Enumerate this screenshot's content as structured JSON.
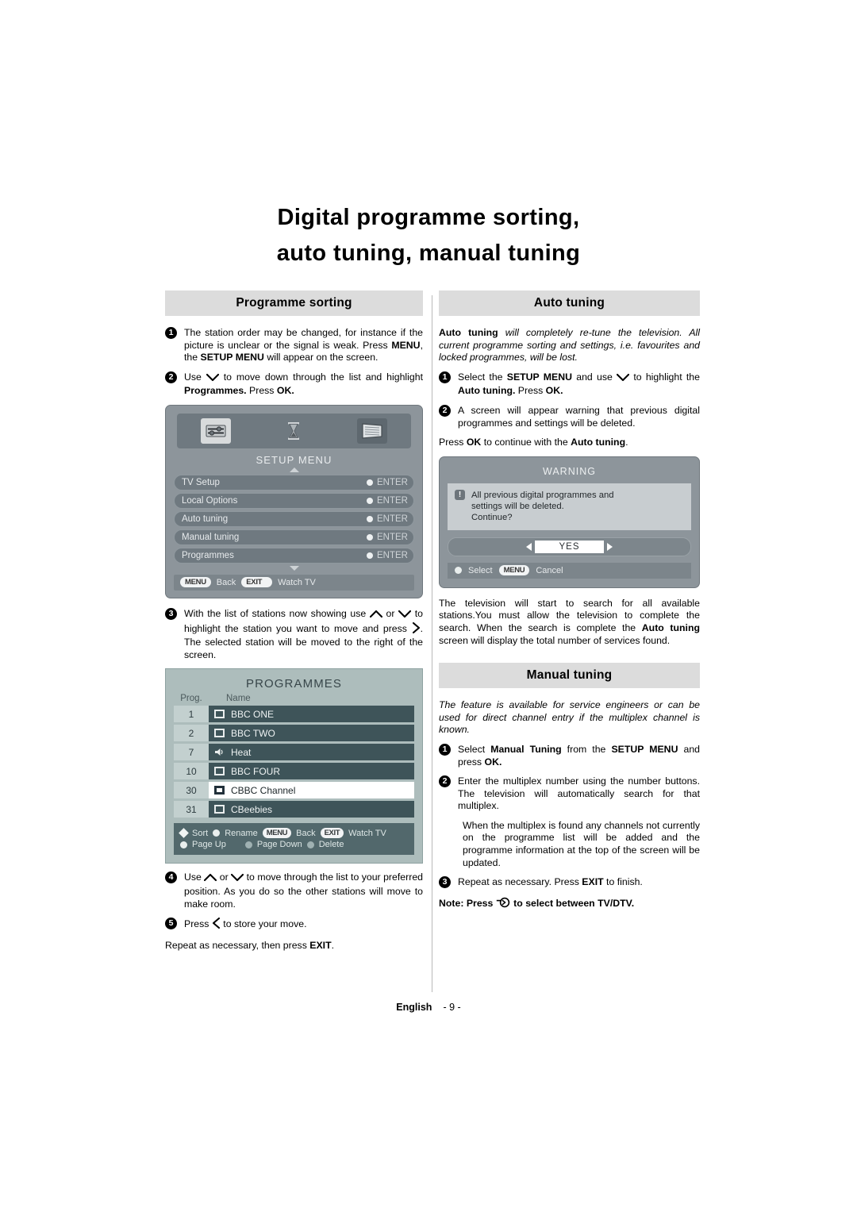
{
  "title": {
    "line1": "Digital  programme  sorting,",
    "line2": "auto tuning, manual tuning"
  },
  "left_column": {
    "header": "Programme sorting",
    "step1": {
      "num": "1",
      "text_a": "The station order may be changed, for instance if the picture is unclear or the signal is weak.  Press ",
      "bold_a": "MENU",
      "text_b": ", the ",
      "bold_b": "SETUP MENU",
      "text_c": " will appear on the screen."
    },
    "step2": {
      "num": "2",
      "text_a": "Use ",
      "text_b": " to move down through the list  and highlight ",
      "bold_a": "Programmes.",
      "text_c": " Press ",
      "bold_b": "OK."
    },
    "step3": {
      "num": "3",
      "text_a": "With the list of stations now showing use ",
      "text_b": " or ",
      "text_c": " to highlight the station you want to move and press ",
      "text_d": ". The selected station will be moved to the right of the screen."
    },
    "step4": {
      "num": "4",
      "text_a": "Use ",
      "text_b": " or ",
      "text_c": " to move through the list to your preferred position. As you do so the other stations will move to make room."
    },
    "step5": {
      "num": "5",
      "text_a": "Press ",
      "text_b": " to store your move.",
      "follow_a": "Repeat as necessary, then press ",
      "follow_bold": "EXIT",
      "follow_b": "."
    }
  },
  "setup_menu_osd": {
    "icons": [
      "sliders-icon",
      "hourglass-icon",
      "tv-screen-icon"
    ],
    "title": "SETUP MENU",
    "rows": [
      {
        "label": "TV Setup",
        "action": "ENTER"
      },
      {
        "label": "Local Options",
        "action": "ENTER"
      },
      {
        "label": "Auto tuning",
        "action": "ENTER"
      },
      {
        "label": "Manual tuning",
        "action": "ENTER"
      },
      {
        "label": "Programmes",
        "action": "ENTER"
      }
    ],
    "footer": {
      "key1": "MENU",
      "label1": "Back",
      "key2": "EXIT",
      "label2": "Watch TV"
    }
  },
  "programmes_osd": {
    "title": "PROGRAMMES",
    "col_prog": "Prog.",
    "col_name": "Name",
    "rows": [
      {
        "prog": "1",
        "name": "BBC ONE",
        "type": "tv",
        "selected": false
      },
      {
        "prog": "2",
        "name": "BBC TWO",
        "type": "tv",
        "selected": false
      },
      {
        "prog": "7",
        "name": "Heat",
        "type": "radio",
        "selected": false
      },
      {
        "prog": "10",
        "name": "BBC FOUR",
        "type": "tv",
        "selected": false
      },
      {
        "prog": "30",
        "name": "CBBC Channel",
        "type": "tv",
        "selected": true
      },
      {
        "prog": "31",
        "name": "CBeebies",
        "type": "tv",
        "selected": false
      }
    ],
    "footer": {
      "sort": "Sort",
      "rename": "Rename",
      "key_menu": "MENU",
      "back": "Back",
      "key_exit": "EXIT",
      "watch_tv": "Watch TV",
      "page_up": "Page Up",
      "page_down": "Page Down",
      "delete": "Delete"
    }
  },
  "right_column": {
    "header_auto": "Auto tuning",
    "intro_bold": "Auto tuning",
    "intro_italic": " will completely re-tune the television. All current programme sorting and settings, i.e. favourites and locked programmes, will be lost.",
    "step1": {
      "num": "1",
      "text_a": "Select the ",
      "bold_a": "SETUP MENU",
      "text_b": " and use ",
      "text_c": " to highlight the ",
      "bold_b": "Auto tuning.",
      "text_d": " Press ",
      "bold_c": "OK."
    },
    "step2": {
      "num": "2",
      "text_a": "A screen will appear warning that previous digital programmes and settings will be deleted.",
      "follow_a": "Press ",
      "follow_bold_a": "OK",
      "follow_b": " to continue with the ",
      "follow_bold_b": "Auto tuning",
      "follow_c": "."
    },
    "after_warning": "The television will start to search for all available stations.You must allow the television to complete the search. When the search is complete the ",
    "after_warning_bold": "Auto tuning",
    "after_warning_b": " screen will display the total number of services found.",
    "header_manual": "Manual tuning",
    "manual_intro": "The feature is available for service engineers or  can be used for direct channel entry if the multiplex channel is known.",
    "m_step1": {
      "num": "1",
      "text_a": "Select ",
      "bold_a": "Manual Tuning",
      "text_b": " from the ",
      "bold_b": "SETUP MENU",
      "text_c": " and press ",
      "bold_c": "OK."
    },
    "m_step2": {
      "num": "2",
      "text_a": "Enter the multiplex number using the number buttons. The television will automatically search for that multiplex.",
      "follow": "When the multiplex is found any channels not currently on the programme list will be added and the programme information at the top of the screen will be updated."
    },
    "m_step3": {
      "num": "3",
      "text_a": "Repeat as necessary. Press ",
      "bold_a": "EXIT",
      "text_b": " to finish."
    },
    "note": {
      "prefix": "Note: Press ",
      "suffix": " to select between TV/DTV."
    }
  },
  "warning_dialog": {
    "title": "WARNING",
    "icon": "exclamation-icon",
    "message_line1": "All previous digital programmes and",
    "message_line2": "settings will be deleted.",
    "message_line3": "Continue?",
    "yes_label": "YES",
    "footer_select": "Select",
    "footer_key": "MENU",
    "footer_cancel": "Cancel"
  },
  "footer": {
    "language": "English",
    "page": "- 9 -"
  },
  "colors": {
    "section_header_bg": "#dcdcdc",
    "osd_panel": "#8d959b",
    "osd_row": "#6f7980",
    "prog_panel": "#adbdbc",
    "prog_row": "#3e5459",
    "prog_selected": "#ffffff"
  }
}
